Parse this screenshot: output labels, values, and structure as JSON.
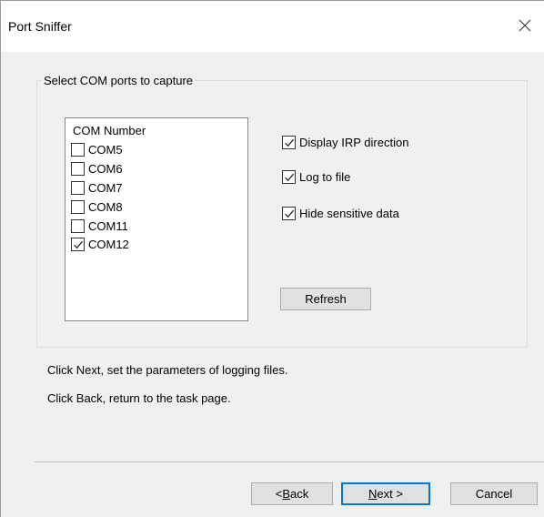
{
  "window": {
    "title": "Port Sniffer"
  },
  "ports_group": {
    "caption": "Select COM ports to capture",
    "list_header": "COM Number",
    "ports": [
      {
        "label": "COM5",
        "checked": false
      },
      {
        "label": "COM6",
        "checked": false
      },
      {
        "label": "COM7",
        "checked": false
      },
      {
        "label": "COM8",
        "checked": false
      },
      {
        "label": "COM11",
        "checked": false
      },
      {
        "label": "COM12",
        "checked": true
      }
    ]
  },
  "options": {
    "display_irp": {
      "label": "Display IRP direction",
      "checked": true
    },
    "log_to_file": {
      "label": "Log to file",
      "checked": true
    },
    "hide_sensitive": {
      "label": "Hide sensitive data",
      "checked": true
    }
  },
  "refresh_label": "Refresh",
  "info": {
    "next_text": "Click Next, set the parameters of logging files.",
    "back_text": "Click Back, return to the task page."
  },
  "buttons": {
    "back_prefix": "< ",
    "back_mnemonic": "B",
    "back_rest": "ack",
    "next_mnemonic": "N",
    "next_rest": "ext >",
    "cancel": "Cancel"
  },
  "icons": {
    "close": "close-icon",
    "check": "checkmark-icon"
  }
}
